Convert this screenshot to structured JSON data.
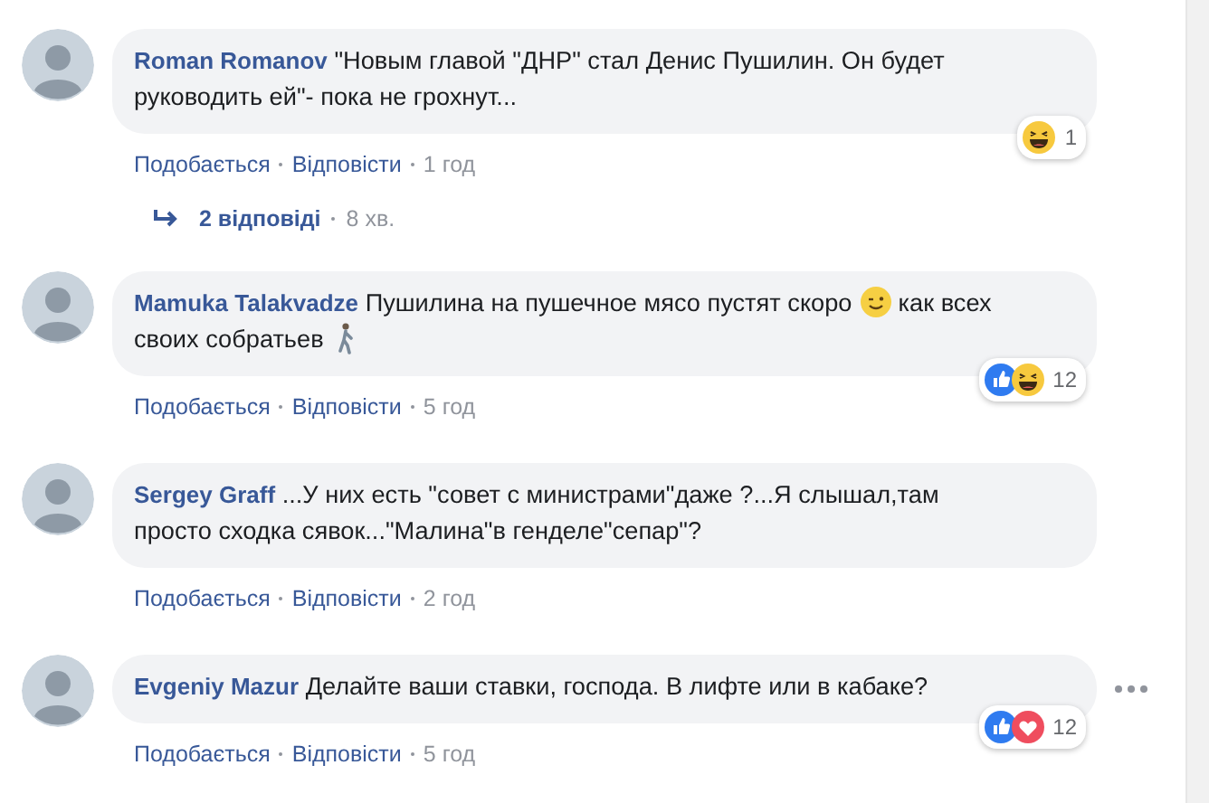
{
  "comments": [
    {
      "author": "Roman Romanov",
      "parts": [
        {
          "kind": "text",
          "text": "\"Новым главой \"ДНР\" стал Денис Пушилин. Он будет руководить ей\"- пока не грохнут..."
        }
      ],
      "reactions": [
        {
          "kind": "haha"
        }
      ],
      "reaction_count": "1",
      "actions": [
        "Подобається",
        "Відповісти"
      ],
      "time": "1 год",
      "replies": {
        "label": "2 відповіді",
        "time": "8 хв."
      }
    },
    {
      "author": "Mamuka Talakvadze",
      "parts": [
        {
          "kind": "text",
          "text": "Пушилина на пушечное мясо пустят скоро "
        },
        {
          "kind": "wink"
        },
        {
          "kind": "text",
          "text": " как всех своих собратьев "
        },
        {
          "kind": "walker"
        }
      ],
      "reactions": [
        {
          "kind": "like"
        },
        {
          "kind": "haha"
        }
      ],
      "reaction_count": "12",
      "actions": [
        "Подобається",
        "Відповісти"
      ],
      "time": "5 год"
    },
    {
      "author": "Sergey Graff",
      "parts": [
        {
          "kind": "text",
          "text": "...У них есть \"совет с министрами\"даже ?...Я слышал,там просто сходка сявок...\"Малина\"в генделе\"сепар\"?"
        }
      ],
      "actions": [
        "Подобається",
        "Відповісти"
      ],
      "time": "2 год"
    },
    {
      "author": "Evgeniy Mazur",
      "parts": [
        {
          "kind": "text",
          "text": "Делайте ваши ставки, господа. В лифте или в кабаке?"
        }
      ],
      "reactions": [
        {
          "kind": "like"
        },
        {
          "kind": "love"
        }
      ],
      "reaction_count": "12",
      "actions": [
        "Подобається",
        "Відповісти"
      ],
      "time": "5 год",
      "more": true
    }
  ]
}
